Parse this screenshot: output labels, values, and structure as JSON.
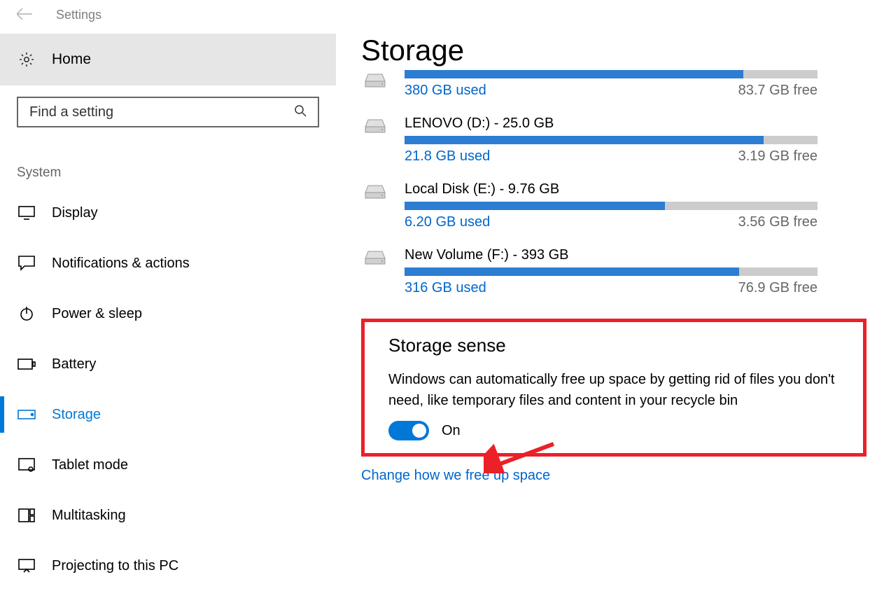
{
  "titlebar": {
    "app_title": "Settings"
  },
  "sidebar": {
    "home": "Home",
    "search_placeholder": "Find a setting",
    "section": "System",
    "items": [
      {
        "label": "Display"
      },
      {
        "label": "Notifications & actions"
      },
      {
        "label": "Power & sleep"
      },
      {
        "label": "Battery"
      },
      {
        "label": "Storage"
      },
      {
        "label": "Tablet mode"
      },
      {
        "label": "Multitasking"
      },
      {
        "label": "Projecting to this PC"
      }
    ]
  },
  "page": {
    "title": "Storage",
    "drives": [
      {
        "name": "",
        "used": "380 GB used",
        "free": "83.7 GB free",
        "percent": 82
      },
      {
        "name": "LENOVO (D:) - 25.0 GB",
        "used": "21.8 GB used",
        "free": "3.19 GB free",
        "percent": 87
      },
      {
        "name": "Local Disk (E:) - 9.76 GB",
        "used": "6.20 GB used",
        "free": "3.56 GB free",
        "percent": 63
      },
      {
        "name": "New Volume (F:) - 393 GB",
        "used": "316 GB used",
        "free": "76.9 GB free",
        "percent": 81
      }
    ],
    "sense": {
      "title": "Storage sense",
      "desc": "Windows can automatically free up space by getting rid of files you don't need, like temporary files and content in your recycle bin",
      "state": "On"
    },
    "link": "Change how we free up space"
  }
}
